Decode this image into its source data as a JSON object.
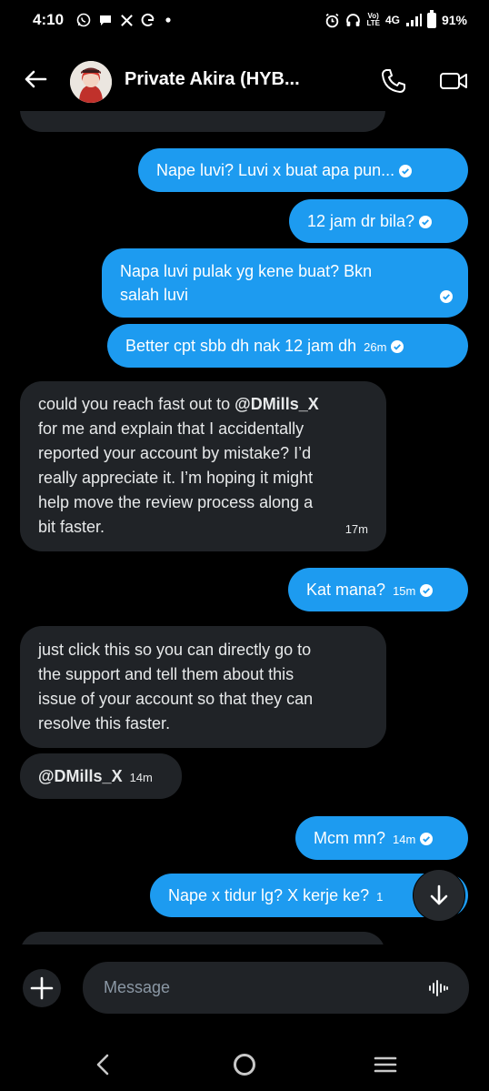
{
  "status_bar": {
    "time": "4:10",
    "icons": [
      "whatsapp-icon",
      "chat-icon",
      "x-icon",
      "google-icon",
      "dot-icon",
      "alarm-icon",
      "headset-icon",
      "volte-icon",
      "signal-icon",
      "battery-icon"
    ],
    "volte_label_top": "Vo)",
    "volte_label_bottom": "LTE",
    "network": "4G",
    "battery": "91%"
  },
  "header": {
    "title": "Private Akira (HYB...",
    "back_icon": "arrow-left-icon",
    "call_icon": "phone-icon",
    "video_icon": "video-camera-icon"
  },
  "messages": [
    {
      "id": "m1",
      "direction": "out",
      "text": "Nape luvi? Luvi x buat apa pun...",
      "time": "",
      "seen": true
    },
    {
      "id": "m2",
      "direction": "out",
      "text": "12 jam dr bila?",
      "time": "",
      "seen": true
    },
    {
      "id": "m3",
      "direction": "out",
      "text_lines": [
        "Napa luvi pulak yg kene buat? Bkn",
        "salah luvi"
      ],
      "time": "",
      "seen": true
    },
    {
      "id": "m4",
      "direction": "out",
      "text": "Better cpt sbb dh nak 12 jam dh",
      "time": "26m",
      "seen": true
    },
    {
      "id": "m5",
      "direction": "in",
      "text_prefix": "could you reach fast out to ",
      "mention": "@DMills_X",
      "text_lines": [
        "for me and explain that I accidentally",
        "reported your account by mistake? I’d",
        "really appreciate it. I’m hoping it might",
        "help move the review process along a",
        "bit faster."
      ],
      "time": "17m"
    },
    {
      "id": "m6",
      "direction": "out",
      "text": "Kat mana?",
      "time": "15m",
      "seen": true
    },
    {
      "id": "m7",
      "direction": "in",
      "text_lines": [
        "just click this so you can directly go to",
        "the support and tell them about this",
        "issue of your account so that they can",
        "resolve this faster."
      ],
      "time": ""
    },
    {
      "id": "m8",
      "direction": "in",
      "mention": "@DMills_X",
      "time": "14m"
    },
    {
      "id": "m9",
      "direction": "out",
      "text": "Mcm mn?",
      "time": "14m",
      "seen": true
    },
    {
      "id": "m10",
      "direction": "out",
      "text": "Nape x tidur lg?  X kerje ke?",
      "time": "1",
      "seen": false
    }
  ],
  "composer": {
    "placeholder": "Message",
    "add_icon": "plus-icon",
    "voice_icon": "voice-wave-icon"
  },
  "scroll_button": {
    "icon": "arrow-down-icon"
  },
  "navbar": {
    "back_icon": "nav-back-icon",
    "home_icon": "nav-home-icon",
    "recents_icon": "nav-recents-icon"
  },
  "colors": {
    "outgoing": "#1d9bf0",
    "incoming": "#202327",
    "background": "#000000"
  }
}
